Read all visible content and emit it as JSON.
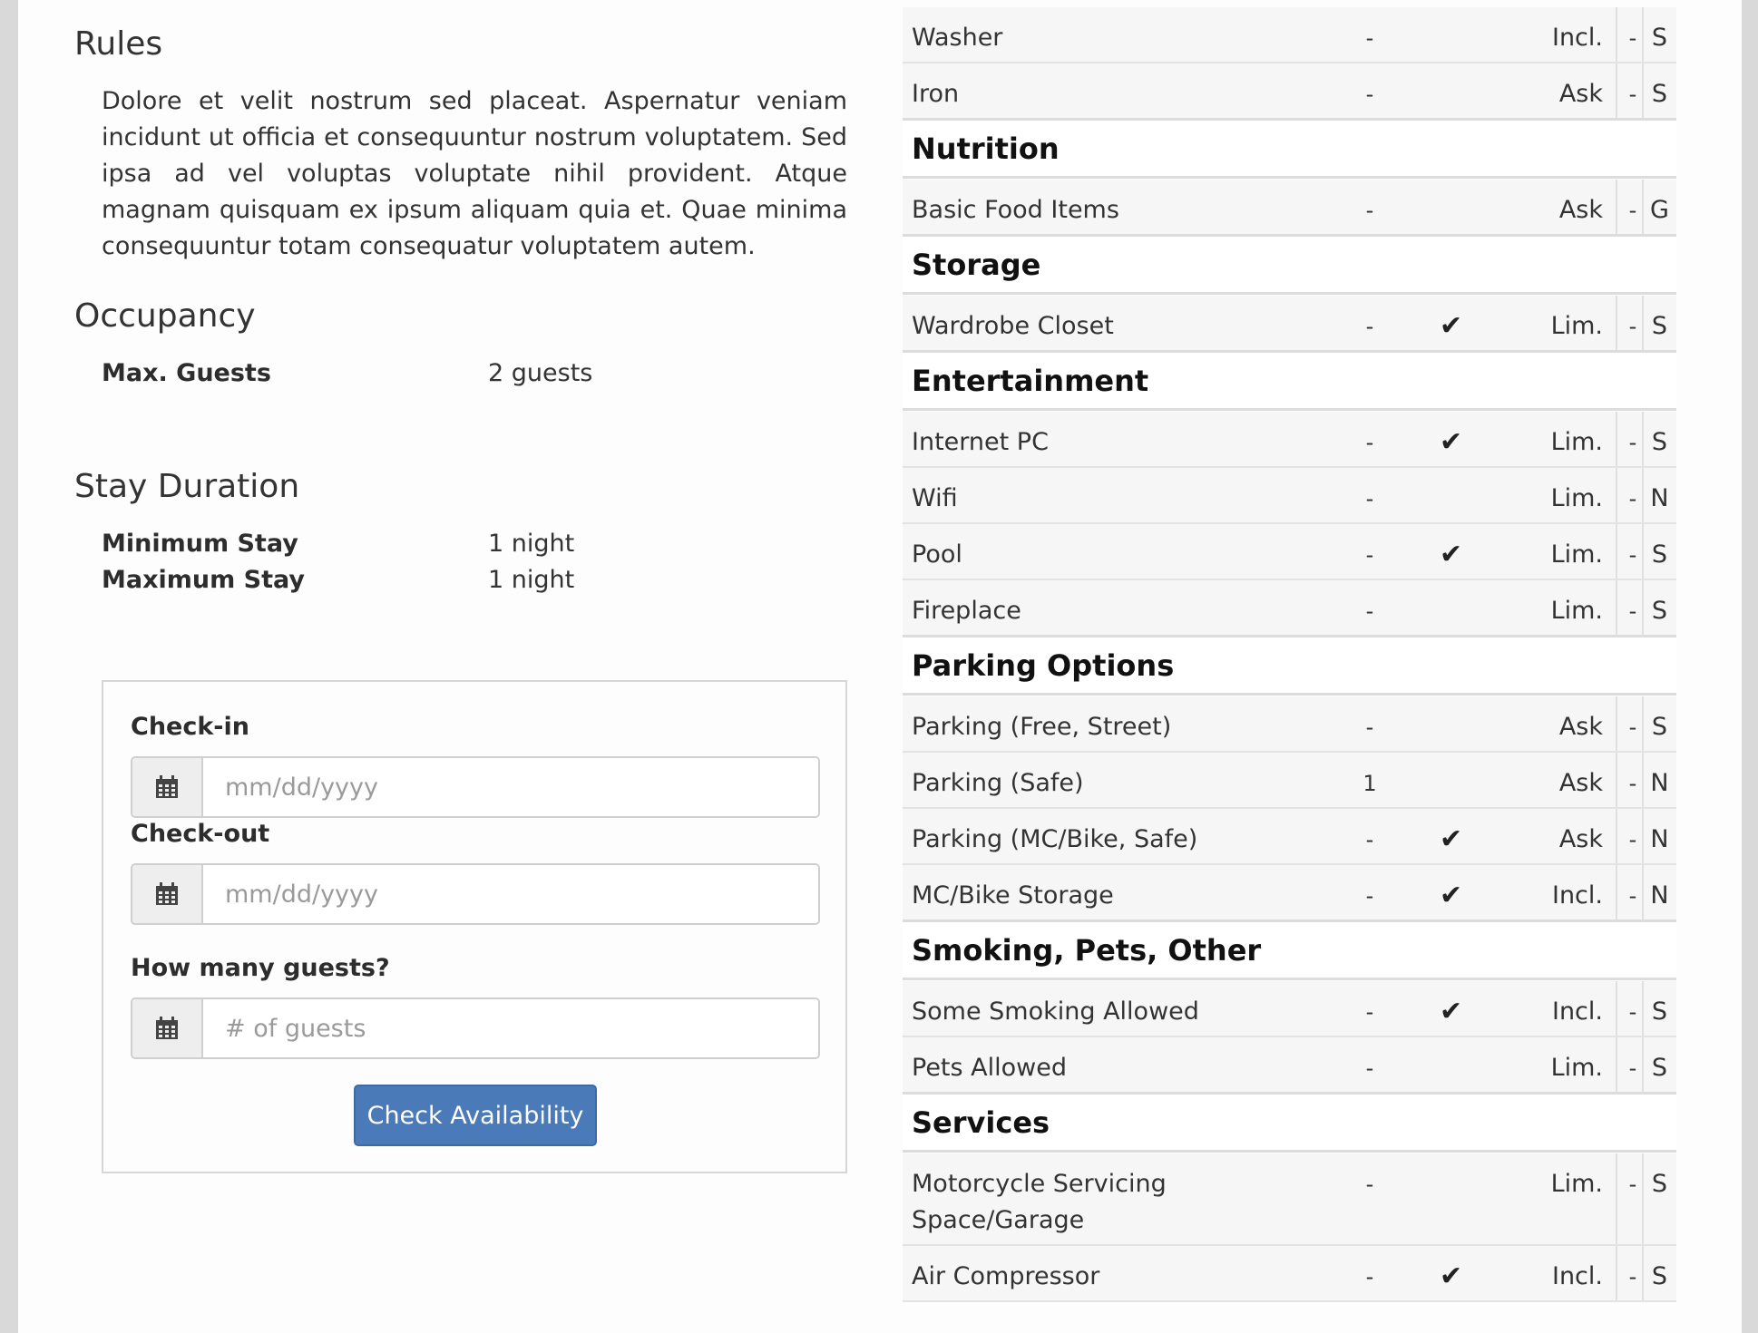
{
  "rules": {
    "title": "Rules",
    "text": "Dolore et velit nostrum sed placeat. Aspernatur veniam incidunt ut officia et consequuntur nostrum voluptatem. Sed ipsa ad vel voluptas voluptate nihil provident. Atque magnam quisquam ex ipsum aliquam quia et. Quae minima consequuntur totam consequatur voluptatem autem."
  },
  "occupancy": {
    "title": "Occupancy",
    "max_guests_label": "Max. Guests",
    "max_guests_value": "2 guests"
  },
  "stay": {
    "title": "Stay Duration",
    "min_label": "Minimum Stay",
    "min_value": "1 night",
    "max_label": "Maximum Stay",
    "max_value": "1 night"
  },
  "booking": {
    "checkin_label": "Check-in",
    "checkin_placeholder": "mm/dd/yyyy",
    "checkout_label": "Check-out",
    "checkout_placeholder": "mm/dd/yyyy",
    "guests_label": "How many guests?",
    "guests_placeholder": "# of guests",
    "button_label": "Check Availability"
  },
  "amenities": {
    "rows": [
      {
        "name": "Washer",
        "qty": "-",
        "check": "",
        "status": "Incl.",
        "dash": "-",
        "code": "S"
      },
      {
        "name": "Iron",
        "qty": "-",
        "check": "",
        "status": "Ask",
        "dash": "-",
        "code": "S"
      },
      {
        "header": "Nutrition"
      },
      {
        "name": "Basic Food Items",
        "qty": "-",
        "check": "",
        "status": "Ask",
        "dash": "-",
        "code": "G"
      },
      {
        "header": "Storage"
      },
      {
        "name": "Wardrobe Closet",
        "qty": "-",
        "check": "✔",
        "status": "Lim.",
        "dash": "-",
        "code": "S"
      },
      {
        "header": "Entertainment"
      },
      {
        "name": "Internet PC",
        "qty": "-",
        "check": "✔",
        "status": "Lim.",
        "dash": "-",
        "code": "S"
      },
      {
        "name": "Wifi",
        "qty": "-",
        "check": "",
        "status": "Lim.",
        "dash": "-",
        "code": "N"
      },
      {
        "name": "Pool",
        "qty": "-",
        "check": "✔",
        "status": "Lim.",
        "dash": "-",
        "code": "S"
      },
      {
        "name": "Fireplace",
        "qty": "-",
        "check": "",
        "status": "Lim.",
        "dash": "-",
        "code": "S"
      },
      {
        "header": "Parking Options"
      },
      {
        "name": "Parking (Free, Street)",
        "qty": "-",
        "check": "",
        "status": "Ask",
        "dash": "-",
        "code": "S"
      },
      {
        "name": "Parking (Safe)",
        "qty": "1",
        "check": "",
        "status": "Ask",
        "dash": "-",
        "code": "N"
      },
      {
        "name": "Parking (MC/Bike, Safe)",
        "qty": "-",
        "check": "✔",
        "status": "Ask",
        "dash": "-",
        "code": "N"
      },
      {
        "name": "MC/Bike Storage",
        "qty": "-",
        "check": "✔",
        "status": "Incl.",
        "dash": "-",
        "code": "N"
      },
      {
        "header": "Smoking, Pets, Other"
      },
      {
        "name": "Some Smoking Allowed",
        "qty": "-",
        "check": "✔",
        "status": "Incl.",
        "dash": "-",
        "code": "S"
      },
      {
        "name": "Pets Allowed",
        "qty": "-",
        "check": "",
        "status": "Lim.",
        "dash": "-",
        "code": "S"
      },
      {
        "header": "Services"
      },
      {
        "name": "Motorcycle Servicing",
        "name2": "Space/Garage",
        "qty": "-",
        "check": "",
        "status": "Lim.",
        "dash": "-",
        "code": "S"
      },
      {
        "name": "Air Compressor",
        "qty": "-",
        "check": "✔",
        "status": "Incl.",
        "dash": "-",
        "code": "S"
      }
    ]
  },
  "icons": {
    "calendar": "calendar-icon",
    "check": "checkmark-icon"
  },
  "colors": {
    "button_bg": "#4a7ab7",
    "page_bg": "#fdfdfd",
    "row_bg": "#f6f6f6"
  }
}
